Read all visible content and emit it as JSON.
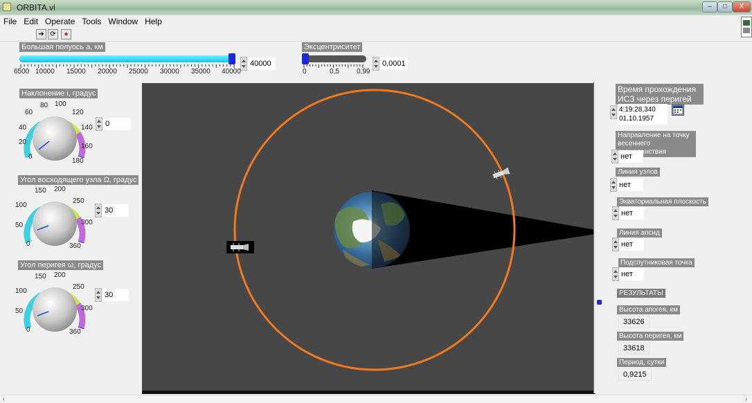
{
  "window": {
    "title": "ORBITA.vi",
    "controls": [
      "–",
      "□",
      "X"
    ]
  },
  "menu": [
    "File",
    "Edit",
    "Operate",
    "Tools",
    "Window",
    "Help"
  ],
  "toolbar": [
    "➔",
    "⟳",
    "●"
  ],
  "semi_axis": {
    "label": "Большая полуось a, км",
    "value": "40000",
    "fraction": 1.0,
    "ticks": [
      "6500",
      "10000",
      "15000",
      "20000",
      "25000",
      "30000",
      "35000",
      "40000"
    ]
  },
  "eccentricity": {
    "label": "Эксцентриситет",
    "value": "0,0001",
    "fraction": 0.0,
    "ticks": [
      "0",
      "0,5",
      "0,99"
    ]
  },
  "inclination": {
    "label": "Наклонение i, градус",
    "value": "0",
    "ticks": [
      "0",
      "20",
      "40",
      "60",
      "80",
      "100",
      "120",
      "140",
      "160",
      "180"
    ]
  },
  "node": {
    "label": "Угол восходящего узла Ω, градус",
    "value": "30",
    "ticks": [
      "0",
      "50",
      "100",
      "150",
      "200",
      "250",
      "300",
      "360"
    ]
  },
  "perigee": {
    "label": "Угол перигея ω, градус",
    "value": "30",
    "ticks": [
      "0",
      "50",
      "100",
      "150",
      "200",
      "250",
      "300",
      "360"
    ]
  },
  "perigee_time": {
    "label": "Время прохождения ИСЗ через перигей",
    "time": "4:19:28,340",
    "date": "01.10.1957"
  },
  "options": [
    {
      "label": "Направление на точку весеннего равноденствия",
      "value": "нет"
    },
    {
      "label": "Линия узлов",
      "value": "нет"
    },
    {
      "label": "Экваториальная плоскость",
      "value": "нет"
    },
    {
      "label": "Линия апсид",
      "value": "нет"
    },
    {
      "label": "Подспутниковая точка",
      "value": "нет"
    }
  ],
  "results": {
    "header": "РЕЗУЛЬТАТЫ",
    "apogee_label": "Высота апогея, км",
    "apogee_value": "33626",
    "perigee_label": "Высота перигея, км",
    "perigee_value": "33618",
    "period_label": "Период, сутки",
    "period_value": "0,9215"
  },
  "colors": {
    "orbit": "#f07a1e",
    "plot_bg": "#474747",
    "slider_fill": "#14c8e6",
    "knob_accent": "#1a2ad6"
  }
}
